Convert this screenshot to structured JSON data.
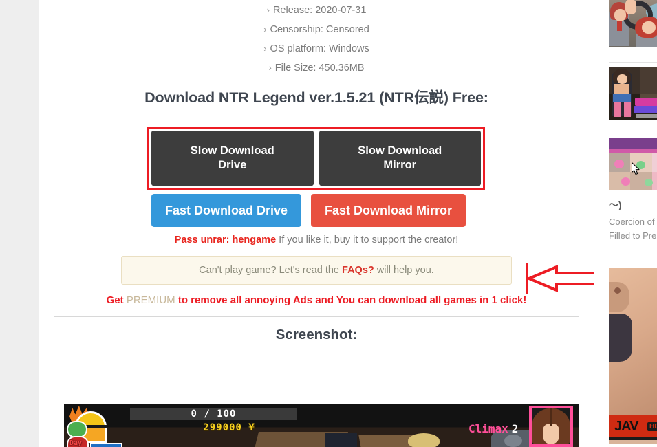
{
  "meta": {
    "chevron": "›",
    "items": [
      "Release: 2020-07-31",
      "Censorship: Censored",
      "OS platform: Windows",
      "File Size: 450.36MB"
    ]
  },
  "download": {
    "heading": "Download NTR Legend ver.1.5.21 (NTR伝説) Free:",
    "slow_drive": "Slow Download\nDrive",
    "slow_mirror": "Slow Download\nMirror",
    "fast_drive": "Fast Download Drive",
    "fast_mirror": "Fast Download Mirror",
    "highlight_color": "#ed1c24",
    "slow_button_color": "#3d3d3d",
    "fast_drive_color": "#3498db",
    "fast_mirror_color": "#e8503f"
  },
  "notes": {
    "pass_strong": "Pass unrar: hengame",
    "pass_rest": " If you like it, buy it to support the creator!",
    "faq_before": "Can't play game? Let's read the ",
    "faq_link": "FAQs?",
    "faq_after": " will help you.",
    "premium_get": "Get ",
    "premium_word": "PREMIUM",
    "premium_rest": " to remove all annoying Ads and You can download all games in 1 click!"
  },
  "screenshot": {
    "heading": "Screenshot:",
    "hud_counter": "0 / 100",
    "hud_money": "299000 ¥",
    "hud_climax_label": "Climax",
    "hud_climax_value": "2",
    "hud_day_label": "Day"
  },
  "sidebar": {
    "title": "〜)",
    "desc_line1": "Coercion of",
    "desc_line2": "Filled to Pre",
    "ad_logo": "JAV",
    "ad_badge": "HD"
  }
}
